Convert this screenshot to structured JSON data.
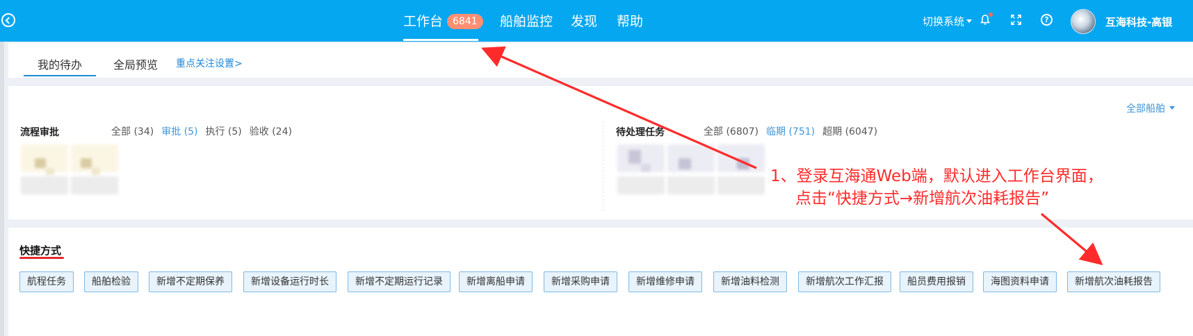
{
  "topbar": {
    "nav": [
      {
        "label": "工作台",
        "badge": "6841"
      },
      {
        "label": "船舶监控"
      },
      {
        "label": "发现"
      },
      {
        "label": "帮助"
      }
    ],
    "switch_system": "切换系统",
    "help_glyph": "?",
    "user_name": "互海科技-高银"
  },
  "tabs": {
    "items": [
      "我的待办",
      "全局预览"
    ],
    "focus_link": "重点关注设置>"
  },
  "main": {
    "all_ships": "全部船舶",
    "approval": {
      "title": "流程审批",
      "filters": [
        "全部 (34)",
        "审批 (5)",
        "执行 (5)",
        "验收 (24)"
      ],
      "active_index": 1
    },
    "tasks": {
      "title": "待处理任务",
      "filters": [
        "全部 (6807)",
        "临期 (751)",
        "超期 (6047)"
      ],
      "active_index": 1
    }
  },
  "shortcuts": {
    "title": "快捷方式",
    "buttons": [
      "航程任务",
      "船舶检验",
      "新增不定期保养",
      "新增设备运行时长",
      "新增不定期运行记录",
      "新增离船申请",
      "新增采购申请",
      "新增维修申请",
      "新增油料检测",
      "新增航次工作汇报",
      "船员费用报销",
      "海图资料申请",
      "新增航次油耗报告"
    ]
  },
  "annotation": {
    "line1": "1、登录互海通Web端，默认进入工作台界面，",
    "line2": "点击“快捷方式→新增航次油耗报告”",
    "color": "#ff2b2b"
  },
  "colors": {
    "topbar": "#05a7f0",
    "accent": "#1e88d6",
    "badge": "#ff8f72"
  }
}
